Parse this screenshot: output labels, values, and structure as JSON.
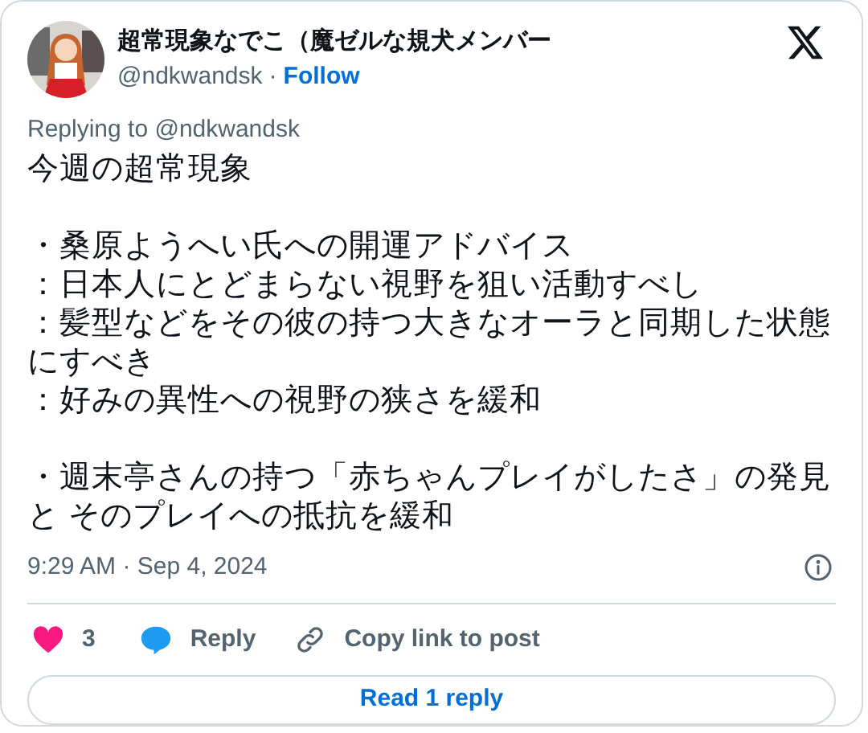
{
  "author": {
    "name": "超常現象なでこ（魔ゼルな規犬メンバー",
    "handle": "@ndkwandsk",
    "separator": "·",
    "follow": "Follow"
  },
  "replying_to": "Replying to @ndkwandsk",
  "body": [
    [
      "今週の超常現象"
    ],
    [
      "・桑原ようへい氏への開運アドバイス",
      "：日本人にとどまらない視野を狙い活動すべし",
      "：髪型などをその彼の持つ大きなオーラと同期した状態にすべき",
      "：好みの異性への視野の狭さを緩和"
    ],
    [
      "・週末亭さんの持つ「赤ちゃんプレイがしたさ」の発見と そのプレイへの抵抗を緩和"
    ]
  ],
  "timestamp": "9:29 AM · Sep 4, 2024",
  "actions": [
    {
      "kind": "like",
      "label": "3"
    },
    {
      "kind": "reply",
      "label": "Reply"
    },
    {
      "kind": "link",
      "label": "Copy link to post"
    }
  ],
  "read_replies": "Read 1 reply"
}
